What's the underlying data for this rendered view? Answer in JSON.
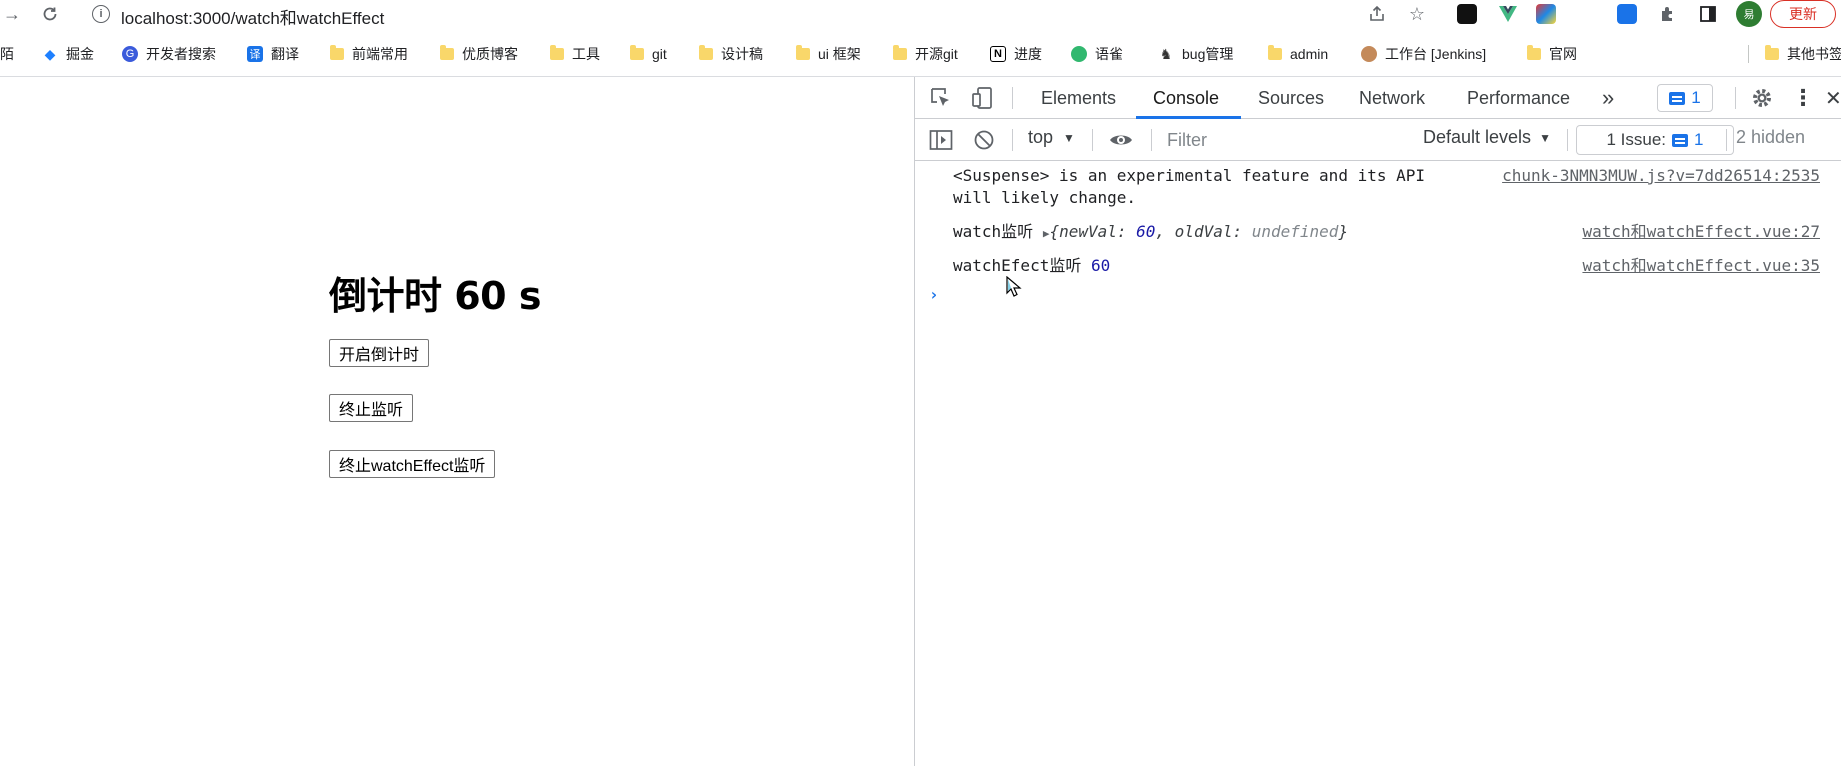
{
  "browser": {
    "url": "localhost:3000/watch和watchEffect",
    "avatar_letter": "易",
    "update_label": "更新"
  },
  "bookmarks": [
    {
      "label": "陌",
      "icon": "folder-icon"
    },
    {
      "label": "掘金",
      "icon": "juejin-icon"
    },
    {
      "label": "开发者搜索",
      "icon": "baidu-dev-icon"
    },
    {
      "label": "翻译",
      "icon": "translate-icon"
    },
    {
      "label": "前端常用",
      "icon": "folder-icon"
    },
    {
      "label": "优质博客",
      "icon": "folder-icon"
    },
    {
      "label": "工具",
      "icon": "folder-icon"
    },
    {
      "label": "git",
      "icon": "folder-icon"
    },
    {
      "label": "设计稿",
      "icon": "folder-icon"
    },
    {
      "label": "ui 框架",
      "icon": "folder-icon"
    },
    {
      "label": "开源git",
      "icon": "folder-icon"
    },
    {
      "label": "进度",
      "icon": "notion-icon"
    },
    {
      "label": "语雀",
      "icon": "yuque-icon"
    },
    {
      "label": "bug管理",
      "icon": "bug-icon"
    },
    {
      "label": "admin",
      "icon": "folder-icon"
    },
    {
      "label": "工作台 [Jenkins]",
      "icon": "jenkins-icon"
    },
    {
      "label": "官网",
      "icon": "folder-icon"
    },
    {
      "label": "其他书签",
      "icon": "folder-icon"
    }
  ],
  "page": {
    "title": "倒计时 60 s",
    "buttons": [
      "开启倒计时",
      "终止监听",
      "终止watchEffect监听"
    ]
  },
  "devtools": {
    "tabs": [
      "Elements",
      "Console",
      "Sources",
      "Network",
      "Performance"
    ],
    "active_tab": "Console",
    "issues_badge": "1",
    "context": "top",
    "filter_placeholder": "Filter",
    "levels": "Default levels",
    "issue_pill_label": "1 Issue:",
    "issue_pill_count": "1",
    "hidden": "2 hidden",
    "logs": [
      {
        "line1": "<Suspense> is an experimental feature and its API",
        "line2": "will likely change.",
        "source": "chunk-3NMN3MUW.js?v=7dd26514:2535"
      },
      {
        "prefix": "watch监听",
        "obj_open": "{",
        "k1": "newVal",
        "v1": "60",
        "k2": "oldVal",
        "v2": "undefined",
        "obj_close": "}",
        "source": "watch和watchEffect.vue:27"
      },
      {
        "prefix": "watchEfect监听",
        "value": "60",
        "source": "watch和watchEffect.vue:35"
      }
    ]
  }
}
